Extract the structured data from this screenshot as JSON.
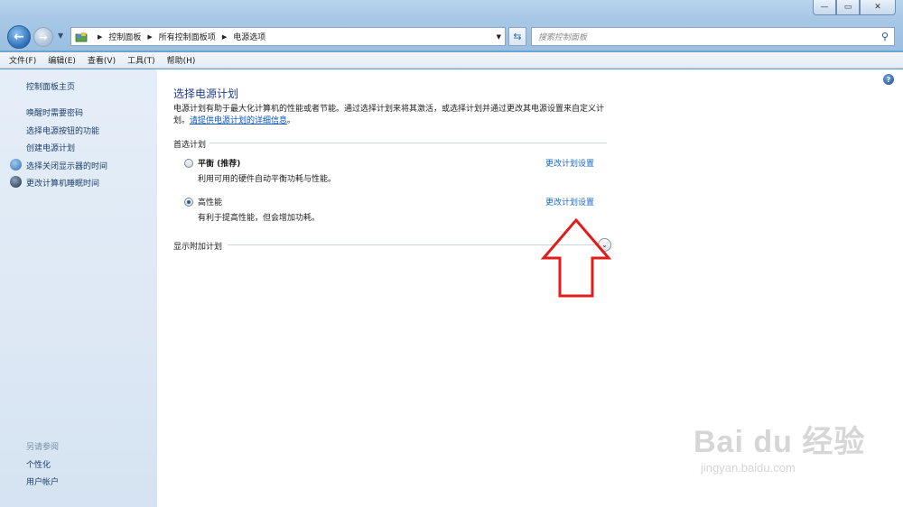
{
  "window": {
    "bg_text": "",
    "controls": [
      "—",
      "▭",
      "✕"
    ]
  },
  "nav": {
    "back_symbol": "←",
    "forward_symbol": "→",
    "breadcrumb": [
      "控制面板",
      "所有控制面板项",
      "电源选项"
    ],
    "search_placeholder": "搜索控制面板"
  },
  "menu": [
    "文件(F)",
    "编辑(E)",
    "查看(V)",
    "工具(T)",
    "帮助(H)"
  ],
  "sidebar": {
    "home": "控制面板主页",
    "items": [
      "唤醒时需要密码",
      "选择电源按钮的功能",
      "创建电源计划",
      "选择关闭显示器的时间",
      "更改计算机睡眠时间"
    ],
    "see_also_title": "另请参阅",
    "see_also": [
      "个性化",
      "用户帐户"
    ]
  },
  "main": {
    "title": "选择电源计划",
    "desc_line1": "电源计划有助于最大化计算机的性能或者节能。通过选择计划来将其激活，或选择计划并通过更改其电源设置来自定义计",
    "desc_line2_prefix": "划。",
    "desc_link": "请提供电源计划的详细信息",
    "desc_line2_suffix": "。",
    "preferred_label": "首选计划",
    "plans": [
      {
        "name": "平衡 (推荐)",
        "desc": "利用可用的硬件自动平衡功耗与性能。",
        "link": "更改计划设置",
        "selected": false
      },
      {
        "name": "高性能",
        "desc": "有利于提高性能，但会增加功耗。",
        "link": "更改计划设置",
        "selected": true
      }
    ],
    "additional_label": "显示附加计划"
  },
  "watermark": {
    "big": "Bai du 经验",
    "small": "jingyan.baidu.com"
  },
  "colors": {
    "accent": "#1f3d8a",
    "link": "#1a69c4",
    "arrow": "#e31b1b"
  }
}
